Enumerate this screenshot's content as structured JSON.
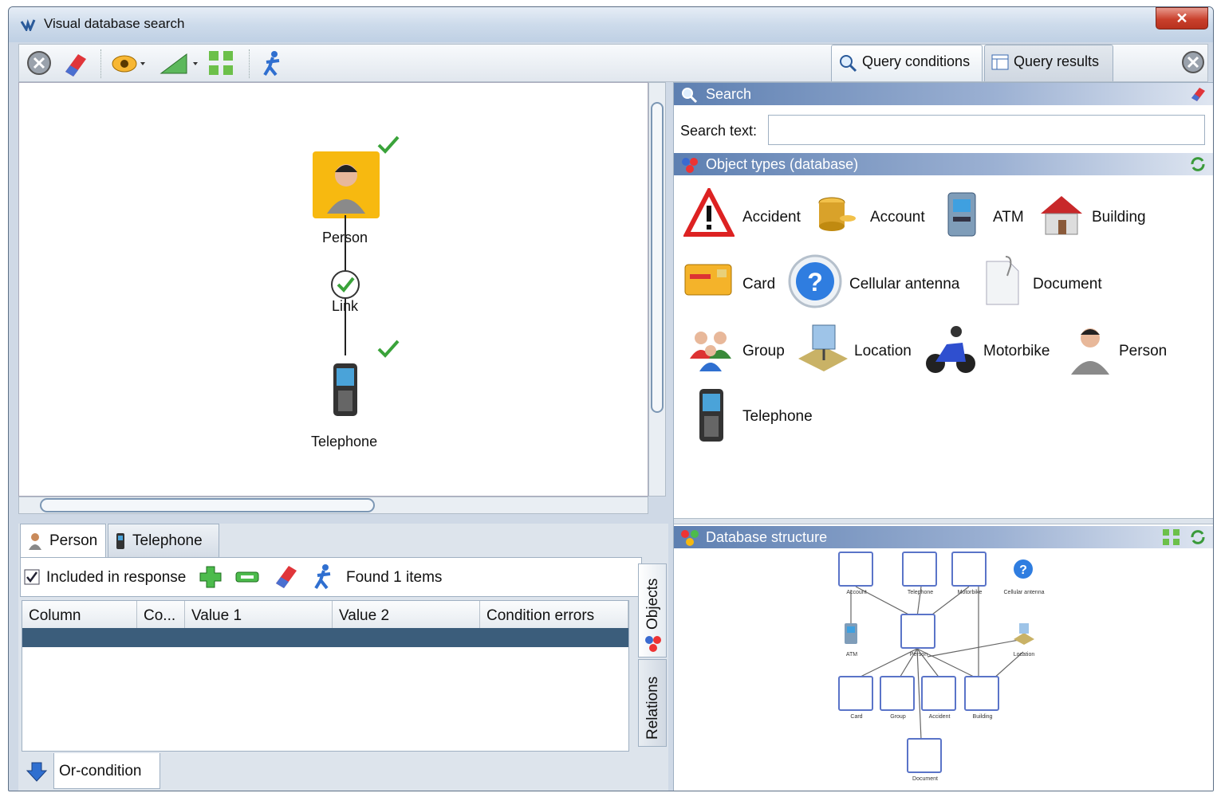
{
  "window": {
    "title": "Visual database search",
    "close_glyph": "✕"
  },
  "toolbar": {
    "tab_conditions": "Query conditions",
    "tab_results": "Query results"
  },
  "graph": {
    "nodes": [
      {
        "label": "Person",
        "icon": "person-icon",
        "checked": true
      },
      {
        "label": "Link",
        "icon": "link-check-icon"
      },
      {
        "label": "Telephone",
        "icon": "telephone-icon",
        "checked": true
      }
    ]
  },
  "bottom": {
    "tabs": [
      "Person",
      "Telephone"
    ],
    "included_label": "Included in response",
    "found_label": "Found 1 items",
    "columns": [
      "Column",
      "Co...",
      "Value 1",
      "Value 2",
      "Condition errors"
    ],
    "side_tabs": [
      "Objects",
      "Relations"
    ],
    "or_condition": "Or-condition"
  },
  "search": {
    "header": "Search",
    "label": "Search text:",
    "value": ""
  },
  "object_types": {
    "header": "Object types (database)",
    "items": [
      "Accident",
      "Account",
      "ATM",
      "Building",
      "Card",
      "Cellular antenna",
      "Document",
      "Group",
      "Location",
      "Motorbike",
      "Person",
      "Telephone"
    ]
  },
  "db_structure": {
    "header": "Database structure",
    "nodes": [
      "Account",
      "Telephone",
      "Motorbike",
      "Cellular antenna",
      "ATM",
      "Person",
      "Location",
      "Card",
      "Group",
      "Accident",
      "Building",
      "Document"
    ]
  },
  "colors": {
    "selected_row": "#3b5d7b",
    "header_grad": "#5d7fb1",
    "check": "#3aa33a"
  }
}
